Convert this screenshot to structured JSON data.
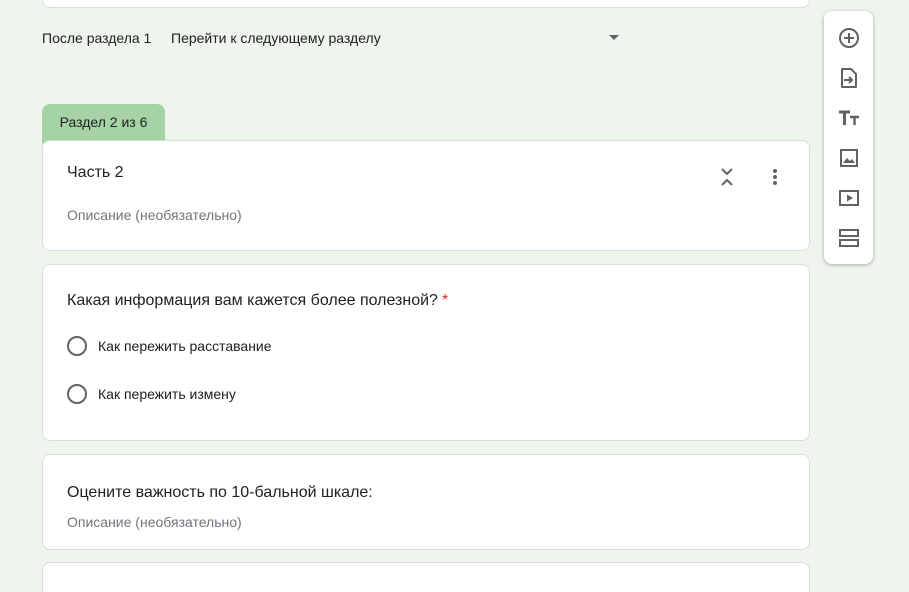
{
  "after_section": {
    "label": "После раздела 1",
    "selected_value": "Перейти к следующему разделу"
  },
  "section": {
    "tab_label": "Раздел 2 из 6",
    "title": "Часть 2",
    "description_placeholder": "Описание (необязательно)"
  },
  "question1": {
    "title": "Какая информация вам кажется более полезной?",
    "required_mark": "*",
    "options": [
      {
        "label": "Как пережить расставание"
      },
      {
        "label": "Как пережить измену"
      }
    ]
  },
  "question2": {
    "title": "Оцените важность по 10-бальной шкале:",
    "description_placeholder": "Описание (необязательно)"
  },
  "toolbar": {
    "items": [
      {
        "icon": "add-circle-icon"
      },
      {
        "icon": "import-question-icon"
      },
      {
        "icon": "title-text-icon"
      },
      {
        "icon": "image-icon"
      },
      {
        "icon": "video-icon"
      },
      {
        "icon": "section-icon"
      }
    ]
  },
  "colors": {
    "background": "#eef5ec",
    "section_tab": "#a5d3a6",
    "required": "#d93025",
    "icon": "#5f6368"
  }
}
